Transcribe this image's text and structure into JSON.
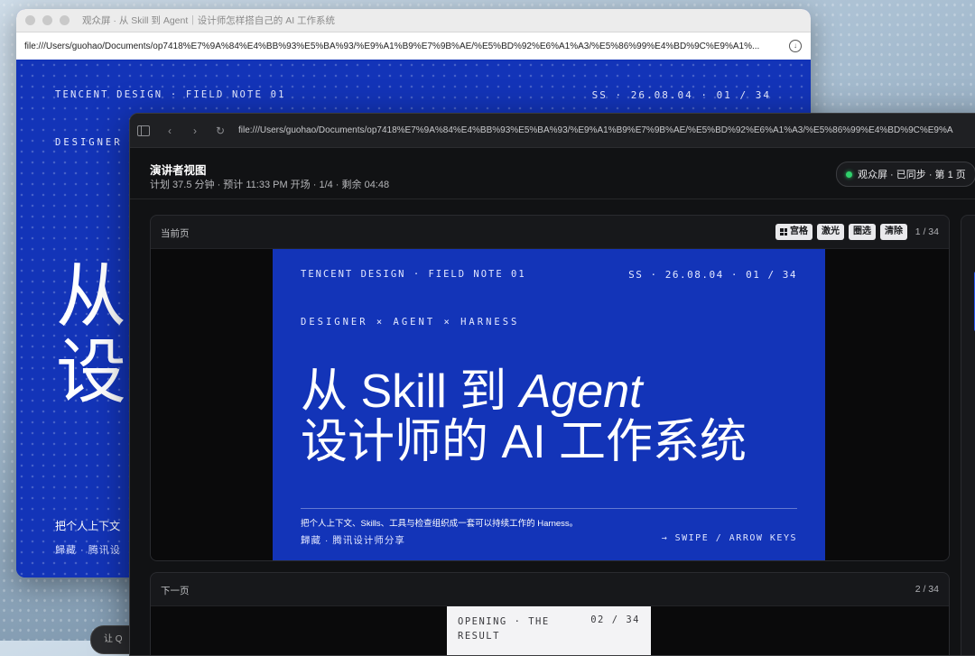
{
  "back_window": {
    "title": "观众屏 · 从 Skill 到 Agent｜设计师怎样搭自己的 AI 工作系统",
    "url": "file:///Users/guohao/Documents/op7418%E7%9A%84%E4%BB%93%E5%BA%93/%E9%A1%B9%E7%9B%AE/%E5%BD%92%E6%A1%A3/%E5%86%99%E4%BD%9C%E9%A1%...",
    "slide": {
      "meta_left": "TENCENT DESIGN · FIELD NOTE 01",
      "meta_right": "SS · 26.08.04 · 01 / 34",
      "kicker": "DESIGNER",
      "big_line1": "从",
      "big_line2": "设",
      "subtitle": "把个人上下文",
      "author": "歸藏 · 腾讯设"
    }
  },
  "front_window": {
    "url": "file:///Users/guohao/Documents/op7418%E7%9A%84%E4%BB%93%E5%BA%93/%E9%A1%B9%E7%9B%AE/%E5%BD%92%E6%A1%A3/%E5%86%99%E4%BD%9C%E9%A",
    "header": {
      "title": "演讲者视图",
      "info": "计划 37.5 分钟 · 预计 11:33 PM   开场 · 1/4 · 剩余 04:48",
      "sync_status": "观众屏 · 已同步 · 第 1 页",
      "sync_color": "#2fd16b"
    },
    "current": {
      "label": "当前页",
      "tools": [
        "宫格",
        "激光",
        "圈选",
        "清除"
      ],
      "count": "1 / 34",
      "slide": {
        "meta_left": "TENCENT DESIGN · FIELD NOTE 01",
        "meta_right": "SS · 26.08.04 · 01 / 34",
        "kicker": "DESIGNER × AGENT × HARNESS",
        "title_line1_prefix": "从 Skill 到 ",
        "title_line1_em": "Agent",
        "title_line2": "设计师的 AI 工作系统",
        "subtitle": "把个人上下文、Skills、工具与检查组织成一套可以持续工作的 Harness。",
        "author": "歸藏 · 腾讯设计师分享",
        "hint": "→ SWIPE / ARROW KEYS"
      }
    },
    "next": {
      "label": "下一页",
      "count": "2 / 34",
      "slide": {
        "section": "OPENING · THE RESULT",
        "number": "02 / 34"
      }
    },
    "slide_color": "#1334b8"
  },
  "background_chip": "让 Q"
}
